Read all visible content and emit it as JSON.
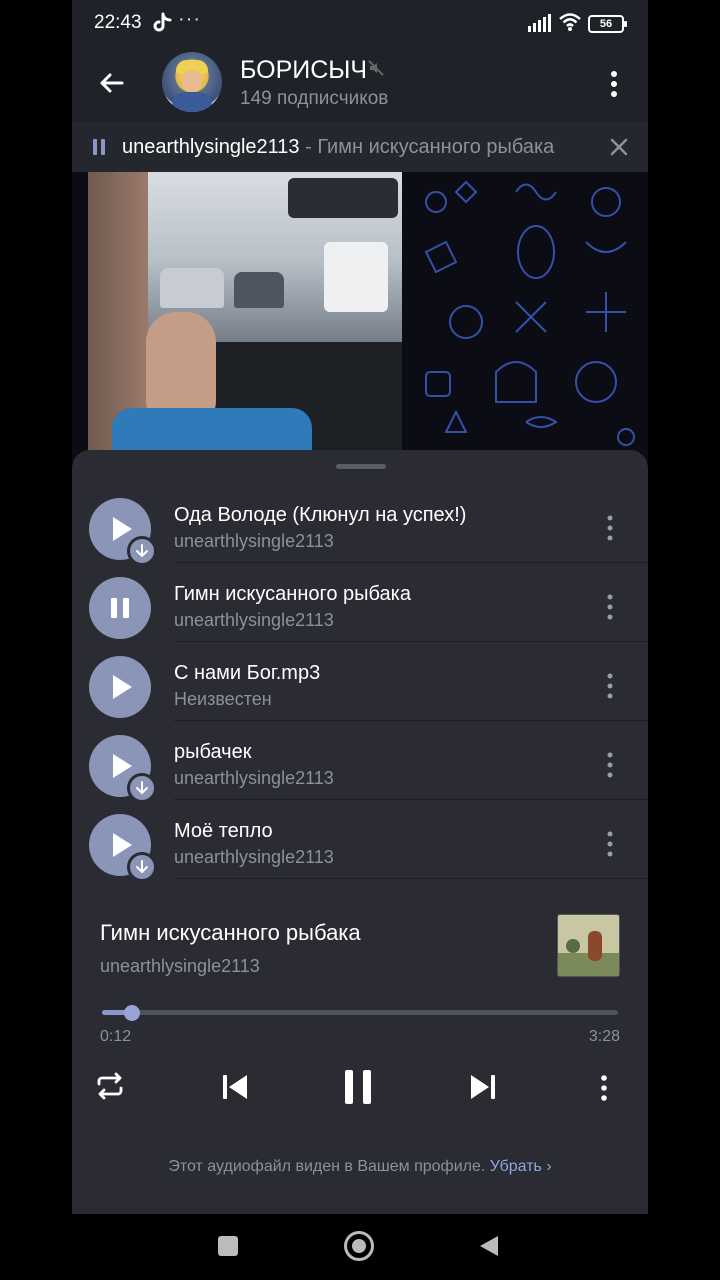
{
  "status_bar": {
    "time": "22:43",
    "battery": "56"
  },
  "header": {
    "channel_name": "БОРИСЫЧ",
    "subscribers": "149 подписчиков"
  },
  "now_playing_bar": {
    "artist": "unearthlysingle2113",
    "separator": "-",
    "title": "Гимн искусанного рыбака"
  },
  "tracks": [
    {
      "title": "Ода Володе (Клюнул на успех!)",
      "subtitle": "unearthlysingle2113",
      "state": "play",
      "download": true
    },
    {
      "title": "Гимн искусанного рыбака",
      "subtitle": "unearthlysingle2113",
      "state": "pause",
      "download": false
    },
    {
      "title": "С нами Бог.mp3",
      "subtitle": "Неизвестен",
      "state": "play",
      "download": false
    },
    {
      "title": "рыбачек",
      "subtitle": "unearthlysingle2113",
      "state": "play",
      "download": true
    },
    {
      "title": "Моё тепло",
      "subtitle": "unearthlysingle2113",
      "state": "play",
      "download": true
    }
  ],
  "player": {
    "title": "Гимн искусанного рыбака",
    "artist": "unearthlysingle2113",
    "current_time": "0:12",
    "total_time": "3:28",
    "progress_fraction": 0.058
  },
  "notice": {
    "text": "Этот аудиофайл виден в Вашем профиле.",
    "link": "Убрать"
  },
  "colors": {
    "accent": "#8a95b8",
    "link": "#8ea6d8",
    "sheet_bg": "#2a2b33"
  }
}
